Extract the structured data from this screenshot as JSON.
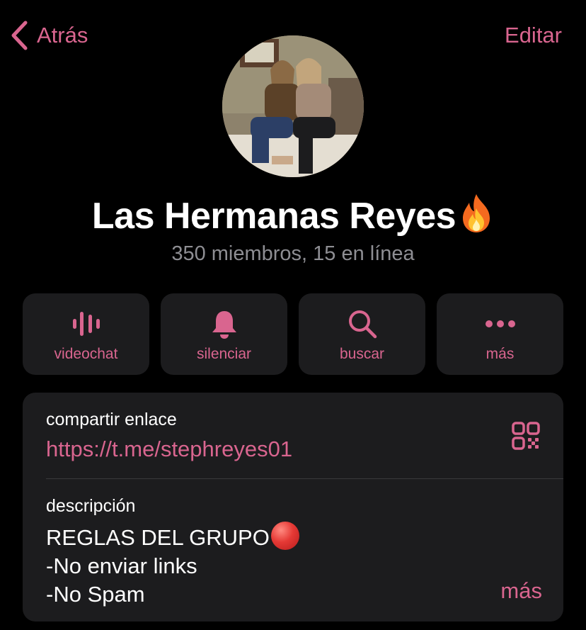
{
  "header": {
    "back_label": "Atrás",
    "edit_label": "Editar"
  },
  "profile": {
    "name": "Las Hermanas Reyes",
    "name_emoji": "fire-icon",
    "status": "350 miembros, 15 en línea"
  },
  "actions": [
    {
      "label": "videochat",
      "icon": "voice-chat-icon"
    },
    {
      "label": "silenciar",
      "icon": "bell-icon"
    },
    {
      "label": "buscar",
      "icon": "search-icon"
    },
    {
      "label": "más",
      "icon": "more-icon"
    }
  ],
  "link": {
    "label": "compartir enlace",
    "url": "https://t.me/stephreyes01",
    "icon": "qr-code-icon"
  },
  "description": {
    "label": "descripción",
    "lines": [
      "REGLAS DEL GRUPO",
      "-No enviar links",
      "-No Spam"
    ],
    "line1_emoji": "red-circle-icon",
    "more_label": "más"
  },
  "colors": {
    "accent": "#d9658f",
    "background": "#000000",
    "card": "#1c1c1e",
    "secondary_text": "#8e8e93"
  }
}
